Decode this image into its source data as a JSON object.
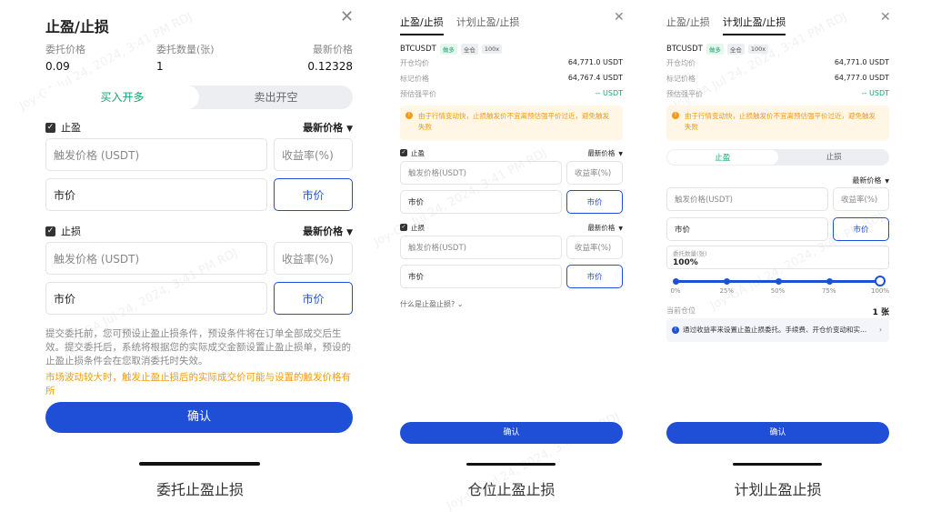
{
  "panel1": {
    "title": "止盈/止损",
    "close": "✕",
    "info": [
      {
        "label": "委托价格",
        "value": "0.09"
      },
      {
        "label": "委托数量(张)",
        "value": "1"
      },
      {
        "label": "最新价格",
        "value": "0.12328"
      }
    ],
    "tabs": [
      "买入开多",
      "卖出开空"
    ],
    "tp": {
      "label": "止盈",
      "dropdown": "最新价格",
      "trigger_placeholder": "触发价格 (USDT)",
      "yield_placeholder": "收益率(%)",
      "market_text": "市价",
      "market_button": "市价"
    },
    "sl": {
      "label": "止损",
      "dropdown": "最新价格",
      "trigger_placeholder": "触发价格 (USDT)",
      "yield_placeholder": "收益率(%)",
      "market_text": "市价",
      "market_button": "市价"
    },
    "note": "提交委托前，您可预设止盈止损条件，预设条件将在订单全部成交后生效。提交委托后，系统将根据您的实际成交金额设置止盈止损单，预设的止盈止损条件会在您取消委托时失效。",
    "warning": "市场波动较大时，触发止盈止损后的实际成交价可能与设置的触发价格有所",
    "confirm": "确认",
    "caption": "委托止盈止损"
  },
  "panel2": {
    "tabs": [
      "止盈/止损",
      "计划止盈/止损"
    ],
    "close": "✕",
    "symbol": "BTCUSDT",
    "tags": [
      "做多",
      "全仓",
      "100x"
    ],
    "rows": [
      {
        "k": "开仓均价",
        "v": "64,771.0 USDT"
      },
      {
        "k": "标记价格",
        "v": "64,767.4 USDT"
      },
      {
        "k": "预估强平价",
        "v": "-- USDT"
      }
    ],
    "notice": "由于行情变动快，止损触发价不宜离预估强平价过近，避免触发失败",
    "tp": {
      "label": "止盈",
      "dropdown": "最新价格",
      "trigger_placeholder": "触发价格(USDT)",
      "yield_placeholder": "收益率(%)",
      "market_text": "市价",
      "market_button": "市价"
    },
    "sl": {
      "label": "止损",
      "dropdown": "最新价格",
      "trigger_placeholder": "触发价格(USDT)",
      "yield_placeholder": "收益率(%)",
      "market_text": "市价",
      "market_button": "市价"
    },
    "whatis": "什么是止盈止损?",
    "confirm": "确认",
    "caption": "仓位止盈止损"
  },
  "panel3": {
    "tabs": [
      "止盈/止损",
      "计划止盈/止损"
    ],
    "close": "✕",
    "symbol": "BTCUSDT",
    "tags": [
      "做多",
      "全仓",
      "100x"
    ],
    "rows": [
      {
        "k": "开仓均价",
        "v": "64,771.0 USDT"
      },
      {
        "k": "标记价格",
        "v": "64,777.0 USDT"
      },
      {
        "k": "预估强平价",
        "v": "-- USDT"
      }
    ],
    "notice": "由于行情变动快，止损触发价不宜离预估强平价过近，避免触发失败",
    "seg": [
      "止盈",
      "止损"
    ],
    "dropdown": "最新价格",
    "trigger_placeholder": "触发价格(USDT)",
    "yield_placeholder": "收益率(%)",
    "market_text": "市价",
    "market_button": "市价",
    "qty_label": "委托数量(张)",
    "qty_value": "100%",
    "slider_value": 1.0,
    "ticks": [
      "0%",
      "25%",
      "50%",
      "75%",
      "100%"
    ],
    "position_label": "当前仓位",
    "position_value": "1 张",
    "hint": "通过收益率来设置止盈止损委托。手续费、开仓价变动和实...",
    "confirm": "确认",
    "caption": "计划止盈止损"
  },
  "icons": {
    "check": "✓",
    "triangle": "▼",
    "chevron_down": "⌄",
    "chevron_right": "›",
    "info": "!"
  },
  "watermark": "Joy-GA Jul 24, 2024, 3:41 PM RDJ"
}
